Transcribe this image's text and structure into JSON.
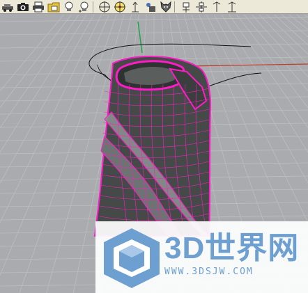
{
  "window": {
    "title": ""
  },
  "toolbar": {
    "buttons": [
      {
        "icon": "car-icon"
      },
      {
        "icon": "camera-icon"
      },
      {
        "icon": "print-icon"
      },
      {
        "icon": "folder-image-icon"
      },
      {
        "icon": "light-bulb-icon"
      },
      {
        "icon": "light-bulb-plus-icon"
      },
      {
        "icon": "osnap-circle-icon"
      },
      {
        "icon": "osnap-point-icon"
      },
      {
        "icon": "axis-icon"
      },
      {
        "icon": "material-icon"
      },
      {
        "icon": "wolf-head-icon"
      },
      {
        "icon": "gumball-icon"
      },
      {
        "icon": "grid-snap-icon"
      },
      {
        "icon": "pin-icon"
      },
      {
        "icon": "planar-icon"
      }
    ]
  },
  "viewport": {
    "background_color": "#a9abae",
    "grid_color": "#bdbec0",
    "axis_y_color": "#21a34a",
    "axis_x_color": "#c0392b",
    "selection_color": "#ff1cc8",
    "object_color": "#454a49",
    "curve_color": "#111111"
  },
  "watermark": {
    "title": "3D世界网",
    "url": "WWW.3DSJW.COM",
    "color": "#6d9fd1"
  }
}
